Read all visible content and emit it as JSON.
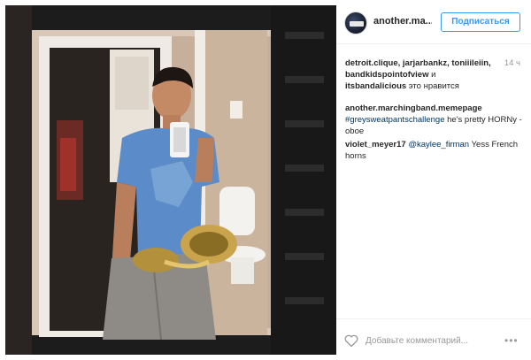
{
  "post": {
    "photo_alt": "",
    "header": {
      "username": "another.ma...",
      "follow_label": "Подписаться"
    },
    "likes": {
      "names": "detroit.clique, jarjarbankz, toniiileiin, bandkidspointofview",
      "connector": "и",
      "last_name": "itsbandalicious",
      "suffix": "это нравится",
      "time": "14 ч"
    },
    "comments": [
      {
        "user": "another.marchingband.memepage",
        "tag": "#greysweatpantschallenge",
        "text": "he's pretty HORNy - oboe"
      },
      {
        "user": "violet_meyer17",
        "tag": "@kaylee_firman",
        "text": "Yess French horns"
      }
    ],
    "footer": {
      "add_comment_placeholder": "Добавьте комментарий...",
      "more_icon": "ellipsis-icon",
      "like_icon": "heart-icon"
    }
  },
  "colors": {
    "accent": "#3897f0",
    "link": "#003569",
    "muted": "#999999",
    "text": "#262626"
  }
}
